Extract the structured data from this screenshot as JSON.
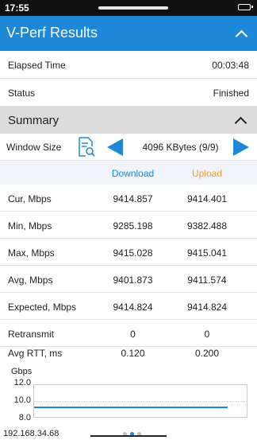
{
  "status_bar": {
    "time": "17:55"
  },
  "app_bar": {
    "title": "V-Perf Results"
  },
  "info": [
    {
      "label": "Elapsed Time",
      "value": "00:03:48"
    },
    {
      "label": "Status",
      "value": "Finished"
    }
  ],
  "summary": {
    "title": "Summary",
    "window_size_label": "Window Size",
    "window_size_value": "4096 KBytes (9/9)",
    "columns": {
      "download": "Download",
      "upload": "Upload"
    },
    "rows": [
      {
        "name": "Cur, Mbps",
        "download": "9414.857",
        "upload": "9414.401"
      },
      {
        "name": "Min, Mbps",
        "download": "9285.198",
        "upload": "9382.488"
      },
      {
        "name": "Max, Mbps",
        "download": "9415.028",
        "upload": "9415.041"
      },
      {
        "name": "Avg, Mbps",
        "download": "9401.873",
        "upload": "9411.574"
      },
      {
        "name": "Expected, Mbps",
        "download": "9414.824",
        "upload": "9414.824"
      },
      {
        "name": "Retransmit",
        "download": "0",
        "upload": "0"
      },
      {
        "name": "Avg RTT, ms",
        "download": "0.120",
        "upload": "0.200"
      }
    ]
  },
  "chart": {
    "ylabel": "Gbps",
    "ticks": [
      "12.0",
      "10.0",
      "8.0"
    ]
  },
  "footer": {
    "ip": "192.168.34.68"
  },
  "colors": {
    "accent": "#1e88d8",
    "upload": "#f39c2a"
  },
  "icons": [
    "chevron-up-icon",
    "document-search-icon",
    "arrow-left-icon",
    "arrow-right-icon"
  ]
}
